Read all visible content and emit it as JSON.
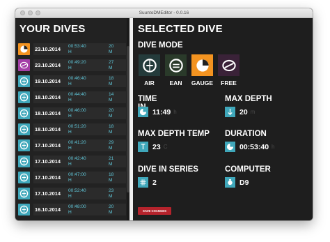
{
  "window": {
    "title": "SuuntoDMEditor - 0.0.16"
  },
  "left": {
    "heading": "YOUR DIVES",
    "dives": [
      {
        "date": "23.10.2014",
        "duration": "00:53:40",
        "duration_unit": "H",
        "depth": "20",
        "depth_unit": "M",
        "mode": "gauge",
        "color": "#f39320"
      },
      {
        "date": "23.10.2014",
        "duration": "00:49:20",
        "duration_unit": "H",
        "depth": "27",
        "depth_unit": "M",
        "mode": "free",
        "color": "#a43fa7"
      },
      {
        "date": "19.10.2014",
        "duration": "00:46:40",
        "duration_unit": "H",
        "depth": "18",
        "depth_unit": "M",
        "mode": "air",
        "color": "#3fa7ba"
      },
      {
        "date": "18.10.2014",
        "duration": "00:44:40",
        "duration_unit": "H",
        "depth": "14",
        "depth_unit": "M",
        "mode": "air",
        "color": "#3fa7ba"
      },
      {
        "date": "18.10.2014",
        "duration": "00:46:00",
        "duration_unit": "H",
        "depth": "20",
        "depth_unit": "M",
        "mode": "air",
        "color": "#3fa7ba"
      },
      {
        "date": "18.10.2014",
        "duration": "00:51:20",
        "duration_unit": "H",
        "depth": "18",
        "depth_unit": "M",
        "mode": "air",
        "color": "#3fa7ba"
      },
      {
        "date": "17.10.2014",
        "duration": "00:41:20",
        "duration_unit": "H",
        "depth": "29",
        "depth_unit": "M",
        "mode": "air",
        "color": "#3fa7ba"
      },
      {
        "date": "17.10.2014",
        "duration": "00:42:40",
        "duration_unit": "H",
        "depth": "21",
        "depth_unit": "M",
        "mode": "air",
        "color": "#3fa7ba"
      },
      {
        "date": "17.10.2014",
        "duration": "00:47:00",
        "duration_unit": "H",
        "depth": "18",
        "depth_unit": "M",
        "mode": "air",
        "color": "#3fa7ba"
      },
      {
        "date": "17.10.2014",
        "duration": "00:52:40",
        "duration_unit": "H",
        "depth": "23",
        "depth_unit": "M",
        "mode": "air",
        "color": "#3fa7ba"
      },
      {
        "date": "16.10.2014",
        "duration": "00:48:00",
        "duration_unit": "H",
        "depth": "20",
        "depth_unit": "M",
        "mode": "air",
        "color": "#3fa7ba"
      }
    ]
  },
  "right": {
    "heading": "SELECTED DIVE",
    "dive_mode": {
      "label": "DIVE MODE",
      "selected": "GAUGE",
      "options": [
        {
          "label": "AIR",
          "icon": "air-icon",
          "bg": "#243b3b"
        },
        {
          "label": "EAN",
          "icon": "ean-icon",
          "bg": "#2a3a2a"
        },
        {
          "label": "GAUGE",
          "icon": "gauge-icon",
          "bg": "#f39320"
        },
        {
          "label": "FREE",
          "icon": "free-icon",
          "bg": "#3a2238"
        }
      ]
    },
    "fields": {
      "time_in": {
        "label": "TIME IN",
        "value": "11:49",
        "unit": "h",
        "icon": "clock-icon"
      },
      "max_depth": {
        "label": "MAX DEPTH",
        "value": "20",
        "unit": "m",
        "icon": "down-arrow-icon"
      },
      "max_depth_temp": {
        "label": "MAX DEPTH TEMP",
        "value": "23",
        "unit": "C",
        "icon": "thermometer-icon"
      },
      "duration": {
        "label": "DURATION",
        "value": "00:53:40",
        "unit": "h",
        "icon": "clock-icon"
      },
      "dive_in_series": {
        "label": "DIVE IN SERIES",
        "value": "2",
        "unit": "",
        "icon": "hash-icon"
      },
      "computer": {
        "label": "COMPUTER",
        "value": "D9",
        "unit": "",
        "icon": "computer-icon"
      }
    },
    "save_label": "SAVE CHANGES"
  }
}
